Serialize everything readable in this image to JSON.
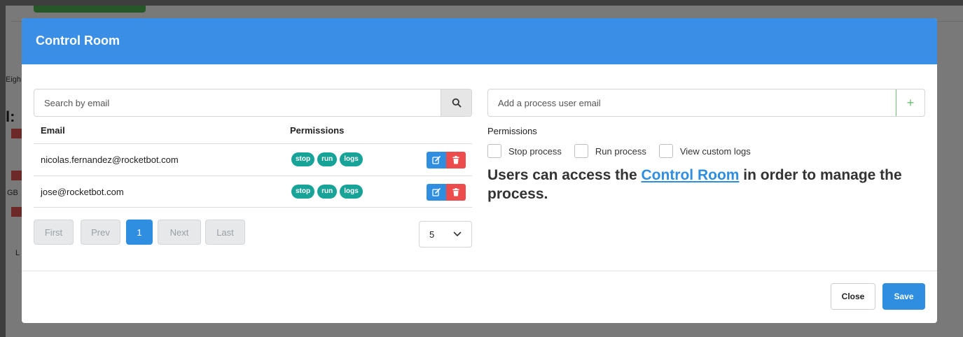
{
  "background": {
    "fragments": [
      "Eigh",
      "I: ",
      "GB",
      "L"
    ]
  },
  "modal": {
    "title": "Control Room",
    "search": {
      "placeholder": "Search by email"
    },
    "table": {
      "headers": {
        "email": "Email",
        "permissions": "Permissions"
      },
      "rows": [
        {
          "email": "nicolas.fernandez@rocketbot.com",
          "permissions": [
            "stop",
            "run",
            "logs"
          ]
        },
        {
          "email": "jose@rocketbot.com",
          "permissions": [
            "stop",
            "run",
            "logs"
          ]
        }
      ]
    },
    "pagination": {
      "first": "First",
      "prev": "Prev",
      "current": "1",
      "next": "Next",
      "last": "Last",
      "page_size": "5"
    },
    "add_user": {
      "placeholder": "Add a process user email",
      "button": "+"
    },
    "permissions": {
      "label": "Permissions",
      "options": [
        "Stop process",
        "Run process",
        "View custom logs"
      ]
    },
    "info": {
      "prefix": "Users can access the ",
      "link": "Control Room",
      "suffix": " in order to manage the process."
    },
    "footer": {
      "close": "Close",
      "save": "Save"
    }
  },
  "colors": {
    "header": "#3a8ee6",
    "primary": "#2f8ee0",
    "badge": "#17a398",
    "danger": "#ec4c4c",
    "add": "#6cc070"
  }
}
